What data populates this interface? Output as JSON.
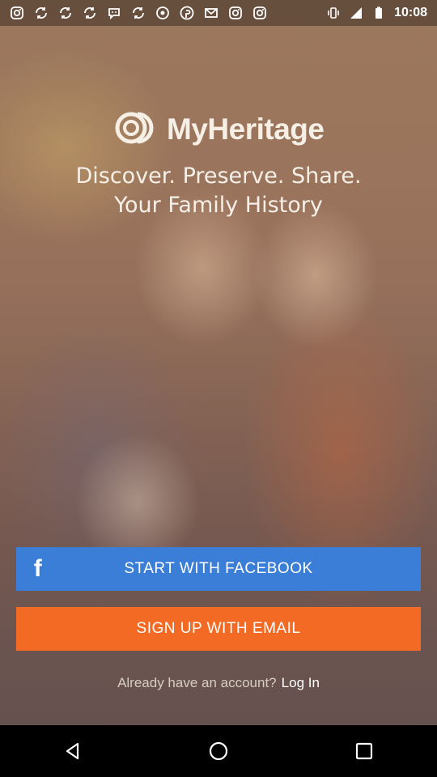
{
  "status_bar": {
    "time": "10:08",
    "left_icons": [
      "instagram-icon",
      "sync-icon",
      "sync-icon",
      "sync-icon",
      "bitmoji-icon",
      "sync-icon",
      "target-icon",
      "pinterest-icon",
      "mail-icon",
      "instagram-icon",
      "instagram-icon"
    ],
    "right_icons": [
      "vibrate-icon",
      "signal-icon",
      "battery-icon"
    ]
  },
  "logo": {
    "text": "MyHeritage"
  },
  "tagline": {
    "line1": "Discover. Preserve. Share.",
    "line2": "Your Family History"
  },
  "buttons": {
    "facebook_icon": "f",
    "facebook_label": "START WITH FACEBOOK",
    "email_label": "SIGN UP WITH EMAIL"
  },
  "login": {
    "question": "Already have an account?",
    "link": "Log In"
  },
  "colors": {
    "facebook_blue": "#3b7ed8",
    "email_orange": "#f26a24"
  },
  "nav_bar": {
    "icons": [
      "back-icon",
      "home-icon",
      "recents-icon"
    ]
  }
}
